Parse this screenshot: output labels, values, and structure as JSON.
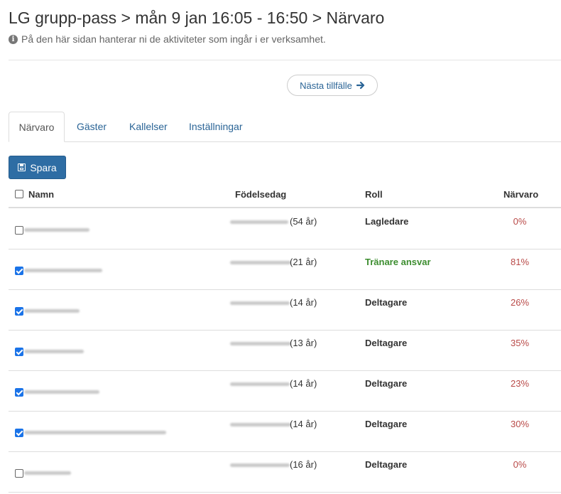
{
  "page": {
    "title": "LG grupp-pass > mån 9 jan 16:05 - 16:50 > Närvaro",
    "subtitle": "På den här sidan hanterar ni de aktiviteter som ingår i er verksamhet.",
    "info_icon": "i",
    "next_button": "Nästa tillfälle",
    "next_icon": "arrow-right-icon"
  },
  "tabs": [
    {
      "label": "Närvaro",
      "active": true
    },
    {
      "label": "Gäster",
      "active": false
    },
    {
      "label": "Kallelser",
      "active": false
    },
    {
      "label": "Inställningar",
      "active": false
    }
  ],
  "toolbar": {
    "save_label": "Spara"
  },
  "table": {
    "headers": {
      "name": "Namn",
      "birthdate": "Födelsedag",
      "role": "Roll",
      "attendance": "Närvaro"
    },
    "rows": [
      {
        "checked": false,
        "age": "(54 år)",
        "role": "Lagledare",
        "attendance": "0%"
      },
      {
        "checked": true,
        "age": "(21 år)",
        "role": "Tränare ansvar",
        "attendance": "81%"
      },
      {
        "checked": true,
        "age": "(14 år)",
        "role": "Deltagare",
        "attendance": "26%"
      },
      {
        "checked": true,
        "age": "(13 år)",
        "role": "Deltagare",
        "attendance": "35%"
      },
      {
        "checked": true,
        "age": "(14 år)",
        "role": "Deltagare",
        "attendance": "23%"
      },
      {
        "checked": true,
        "age": "(14 år)",
        "role": "Deltagare",
        "attendance": "30%"
      },
      {
        "checked": false,
        "age": "(16 år)",
        "role": "Deltagare",
        "attendance": "0%"
      }
    ]
  },
  "colors": {
    "primary": "#2e6da4",
    "link": "#2a6496",
    "leader_role": "#3c8d2f",
    "percent": "#b94a48"
  }
}
